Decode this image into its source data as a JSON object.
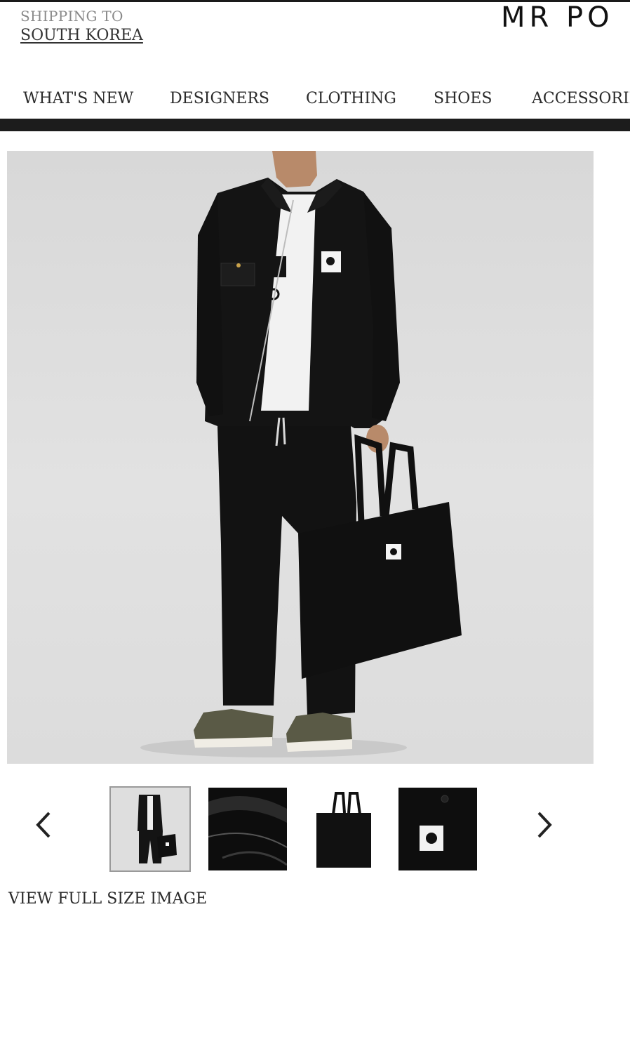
{
  "header": {
    "shipping_label": "SHIPPING TO",
    "shipping_country": "SOUTH KOREA",
    "logo_text": "MR PO"
  },
  "nav": {
    "items": [
      "WHAT'S NEW",
      "DESIGNERS",
      "CLOTHING",
      "SHOES",
      "ACCESSORIES"
    ]
  },
  "gallery": {
    "hero_icon": "product-photo-model-jacket-tote",
    "thumbnails": [
      {
        "icon": "model-full-outfit-thumbnail",
        "active": true
      },
      {
        "icon": "bag-interior-detail-thumbnail",
        "active": false
      },
      {
        "icon": "tote-bag-thumbnail",
        "active": false
      },
      {
        "icon": "logo-patch-detail-thumbnail",
        "active": false
      }
    ],
    "prev_icon": "chevron-left-icon",
    "next_icon": "chevron-right-icon",
    "view_full_label": "VIEW FULL SIZE IMAGE"
  },
  "colors": {
    "nav_bar": "#1c1c1c",
    "product_black": "#121212",
    "background_grey": "#dcdcdc"
  }
}
